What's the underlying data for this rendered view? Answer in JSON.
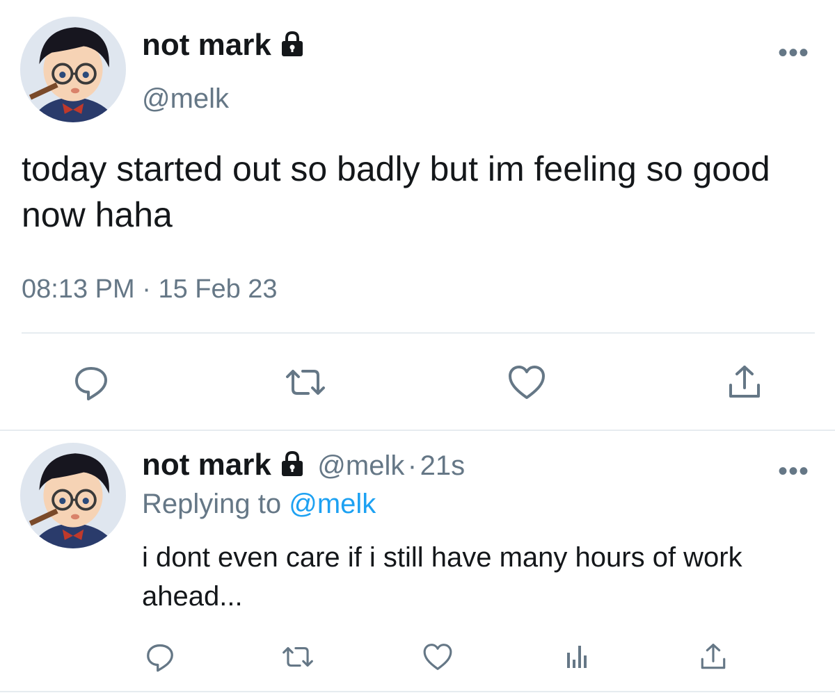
{
  "tweet": {
    "display_name": "not mark",
    "handle": "@melk",
    "text": "today started out so badly but im feeling so good now haha",
    "time": "08:13 PM",
    "separator": "·",
    "date": "15 Feb 23",
    "more_label": "•••"
  },
  "reply": {
    "display_name": "not mark",
    "handle": "@melk",
    "separator": "·",
    "age": "21s",
    "replying_prefix": "Replying to",
    "replying_handle": "@melk",
    "text": "i dont even care if i still have many hours of work ahead...",
    "more_label": "•••"
  },
  "icons": {
    "lock": "lock-icon",
    "reply": "reply-icon",
    "retweet": "retweet-icon",
    "like": "heart-icon",
    "share": "share-icon",
    "analytics": "analytics-icon"
  },
  "colors": {
    "text": "#14171a",
    "secondary": "#657786",
    "link": "#1da1f2",
    "divider": "#e6ecf0"
  }
}
